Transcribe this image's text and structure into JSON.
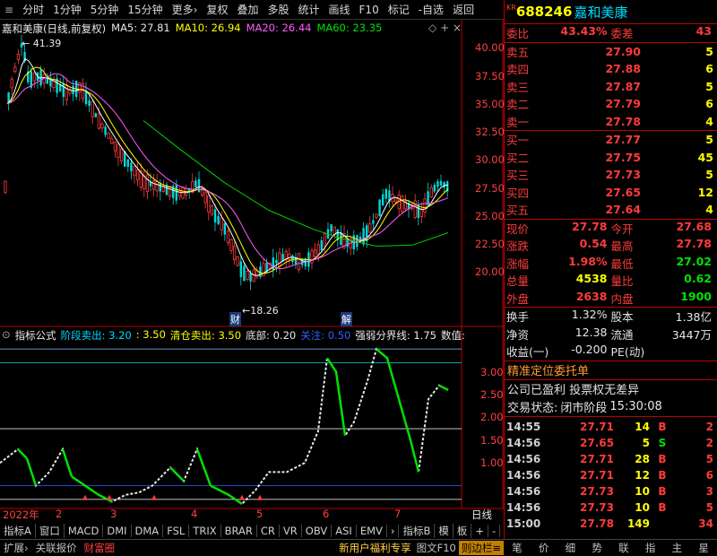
{
  "toolbar": {
    "items": [
      "分时",
      "1分钟",
      "5分钟",
      "15分钟",
      "更多›",
      "复权",
      "叠加",
      "多股",
      "统计",
      "画线",
      "F10",
      "标记",
      "-自选",
      "返回"
    ]
  },
  "stock": {
    "badge": "KR",
    "code": "688246",
    "name": "嘉和美康"
  },
  "chart_header": {
    "title": "嘉和美康(日线,前复权)",
    "ma5": "MA5: 27.81",
    "ma10": "MA10: 26.94",
    "ma20": "MA20: 26.44",
    "ma60": "MA60: 23.35"
  },
  "price_axis": {
    "labels": [
      "40.00",
      "37.50",
      "35.00",
      "32.50",
      "30.00",
      "27.50",
      "25.00",
      "22.50",
      "20.00"
    ],
    "high_mark": "41.39",
    "low_mark": "18.26",
    "marker_cai": "财",
    "marker_jie": "解"
  },
  "indicator": {
    "title": "指标公式",
    "s1": "阶段卖出: 3.20",
    "s2": ": 3.50",
    "s3": "清仓卖出: 3.50",
    "s4": "底部: 0.20",
    "s5": "关注: 0.50",
    "s6": "强弱分界线: 1.75",
    "s7": "数值:",
    "axis": [
      "3.00",
      "2.50",
      "2.00",
      "1.50",
      "1.00"
    ]
  },
  "dates": {
    "year": "2022年",
    "m2": "2",
    "m3": "3",
    "m4": "4",
    "m5": "5",
    "m6": "6",
    "m7": "7",
    "period": "日线"
  },
  "bottom_tabs": [
    "指标A",
    "窗口",
    "MACD",
    "DMI",
    "DMA",
    "FSL",
    "TRIX",
    "BRAR",
    "CR",
    "VR",
    "OBV",
    "ASI",
    "EMV",
    "›",
    "指标B",
    "模",
    "板",
    "+",
    "-"
  ],
  "status_bar": {
    "left": [
      "扩展›",
      "关联报价",
      "财富圈"
    ],
    "right": [
      "新用户福利专享",
      "图文F10",
      "则边栏≡"
    ],
    "icons": [
      "笔",
      "价",
      "细",
      "势",
      "联",
      "指",
      "主",
      "星"
    ]
  },
  "quote": {
    "weibi_l": "委比",
    "weibi_v": "43.43%",
    "weicha_l": "委差",
    "weicha_v": "43",
    "asks": [
      {
        "l": "卖五",
        "p": "27.90",
        "q": "5"
      },
      {
        "l": "卖四",
        "p": "27.88",
        "q": "6"
      },
      {
        "l": "卖三",
        "p": "27.87",
        "q": "5"
      },
      {
        "l": "卖二",
        "p": "27.79",
        "q": "6"
      },
      {
        "l": "卖一",
        "p": "27.78",
        "q": "4"
      }
    ],
    "bids": [
      {
        "l": "买一",
        "p": "27.77",
        "q": "5"
      },
      {
        "l": "买二",
        "p": "27.75",
        "q": "45"
      },
      {
        "l": "买三",
        "p": "27.73",
        "q": "5"
      },
      {
        "l": "买四",
        "p": "27.65",
        "q": "12"
      },
      {
        "l": "买五",
        "p": "27.64",
        "q": "4"
      }
    ],
    "stats": [
      [
        {
          "l": "现价",
          "v": "27.78",
          "c": "red"
        },
        {
          "l": "今开",
          "v": "27.68",
          "c": "red"
        }
      ],
      [
        {
          "l": "涨跌",
          "v": "0.54",
          "c": "red"
        },
        {
          "l": "最高",
          "v": "27.78",
          "c": "red"
        }
      ],
      [
        {
          "l": "涨幅",
          "v": "1.98%",
          "c": "red"
        },
        {
          "l": "最低",
          "v": "27.02",
          "c": "green"
        }
      ],
      [
        {
          "l": "总量",
          "v": "4538",
          "c": "yellow"
        },
        {
          "l": "量比",
          "v": "0.62",
          "c": "green"
        }
      ],
      [
        {
          "l": "外盘",
          "v": "2638",
          "c": "red"
        },
        {
          "l": "内盘",
          "v": "1900",
          "c": "green"
        }
      ]
    ],
    "fin": [
      [
        {
          "l": "换手",
          "v": "1.32%"
        },
        {
          "l": "股本",
          "v": "1.38亿"
        }
      ],
      [
        {
          "l": "净资",
          "v": "12.38"
        },
        {
          "l": "流通",
          "v": "3447万"
        }
      ],
      [
        {
          "l": "收益(一)",
          "v": "-0.200"
        },
        {
          "l": "PE(动)",
          "v": ""
        }
      ]
    ],
    "ad_title": "精准定位委托单",
    "info1": "公司已盈利 投票权无差异",
    "info2_l": "交易状态:",
    "info2_v": "闭市阶段",
    "info2_t": "15:30:08"
  },
  "ticks": [
    {
      "t": "14:55",
      "p": "27.71",
      "q": "14",
      "s": "B",
      "r": "2",
      "sc": "red"
    },
    {
      "t": "14:56",
      "p": "27.65",
      "q": "5",
      "s": "S",
      "r": "2",
      "sc": "green"
    },
    {
      "t": "14:56",
      "p": "27.71",
      "q": "28",
      "s": "B",
      "r": "5",
      "sc": "red"
    },
    {
      "t": "14:56",
      "p": "27.71",
      "q": "12",
      "s": "B",
      "r": "6",
      "sc": "red"
    },
    {
      "t": "14:56",
      "p": "27.73",
      "q": "10",
      "s": "B",
      "r": "3",
      "sc": "red"
    },
    {
      "t": "14:56",
      "p": "27.73",
      "q": "10",
      "s": "B",
      "r": "5",
      "sc": "red"
    },
    {
      "t": "15:00",
      "p": "27.78",
      "q": "149",
      "s": "",
      "r": "34",
      "sc": "red"
    }
  ]
}
